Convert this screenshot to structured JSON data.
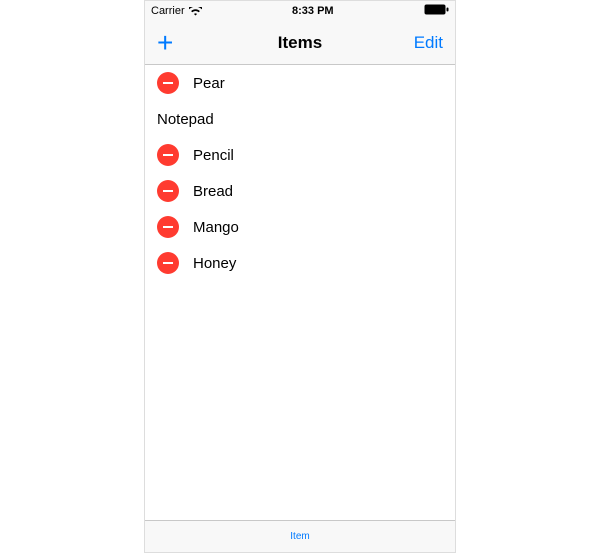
{
  "statusBar": {
    "carrier": "Carrier",
    "time": "8:33 PM"
  },
  "navBar": {
    "title": "Items",
    "addLabel": "+",
    "editLabel": "Edit"
  },
  "list": {
    "items": [
      {
        "label": "Pear",
        "deletable": true
      },
      {
        "label": "Notepad",
        "deletable": false
      },
      {
        "label": "Pencil",
        "deletable": true
      },
      {
        "label": "Bread",
        "deletable": true
      },
      {
        "label": "Mango",
        "deletable": true
      },
      {
        "label": "Honey",
        "deletable": true
      }
    ]
  },
  "toolbar": {
    "itemLabel": "Item"
  },
  "colors": {
    "tint": "#007aff",
    "delete": "#ff3b30",
    "barBg": "#f8f8f8",
    "separator": "#c8c8c8"
  }
}
